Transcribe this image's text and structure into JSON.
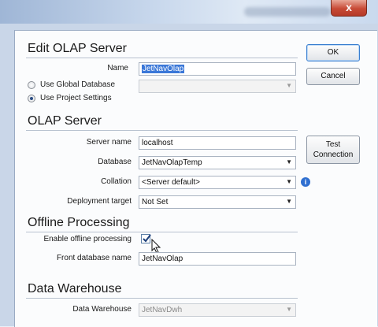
{
  "window": {
    "close_glyph": "x"
  },
  "edit": {
    "heading": "Edit OLAP Server",
    "name_label": "Name",
    "name_value": "JetNavOlap",
    "radio_global": "Use Global Database",
    "radio_project": "Use Project Settings",
    "global_db_value": ""
  },
  "buttons": {
    "ok": "OK",
    "cancel": "Cancel",
    "test_line1": "Test",
    "test_line2": "Connection"
  },
  "olap": {
    "heading": "OLAP Server",
    "server_label": "Server name",
    "server_value": "localhost",
    "database_label": "Database",
    "database_value": "JetNavOlapTemp",
    "collation_label": "Collation",
    "collation_value": "<Server default>",
    "deploy_label": "Deployment target",
    "deploy_value": "Not Set"
  },
  "offline": {
    "heading": "Offline Processing",
    "enable_label": "Enable offline processing",
    "enable_checked": true,
    "front_label": "Front database name",
    "front_value": "JetNavOlap"
  },
  "dwh": {
    "heading": "Data Warehouse",
    "label": "Data Warehouse",
    "value": "JetNavDwh"
  },
  "colors": {
    "accent": "#3a7fd0",
    "info": "#2f6fd0"
  }
}
